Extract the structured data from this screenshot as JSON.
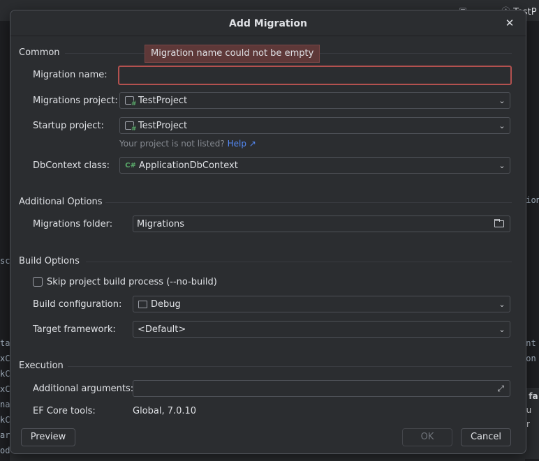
{
  "background": {
    "tab_label": "TestP",
    "left_fragments": [
      "sc",
      "ta",
      "xCo",
      "kCo",
      "xCo",
      "nar",
      "kCo",
      "art",
      "od"
    ],
    "right_fragments": [
      "tion",
      "int",
      "con"
    ],
    "popup_lines": [
      "nd fa",
      "e/su",
      "stPr"
    ]
  },
  "dialog": {
    "title": "Add Migration",
    "error_tooltip": "Migration name could not be empty",
    "sections": {
      "common": "Common",
      "additional": "Additional Options",
      "build": "Build Options",
      "execution": "Execution"
    },
    "fields": {
      "migration_name": {
        "label": "Migration name:",
        "value": ""
      },
      "migrations_project": {
        "label": "Migrations project:",
        "value": "TestProject",
        "icon": "csharp-project-icon"
      },
      "startup_project": {
        "label": "Startup project:",
        "value": "TestProject",
        "icon": "csharp-project-icon"
      },
      "project_hint": {
        "text": "Your project is not listed?",
        "link": "Help ↗"
      },
      "dbcontext_class": {
        "label": "DbContext class:",
        "value": "ApplicationDbContext",
        "icon": "C#"
      },
      "migrations_folder": {
        "label": "Migrations folder:",
        "value": "Migrations",
        "icon": "folder-icon"
      },
      "skip_build": {
        "label": "Skip project build process (--no-build)",
        "checked": false
      },
      "build_configuration": {
        "label": "Build configuration:",
        "value": "Debug",
        "icon": "configuration-icon"
      },
      "target_framework": {
        "label": "Target framework:",
        "value": "<Default>"
      },
      "additional_arguments": {
        "label": "Additional arguments:",
        "value": "",
        "icon": "expand-icon"
      },
      "ef_core_tools": {
        "label": "EF Core tools:",
        "value": "Global, 7.0.10"
      }
    },
    "buttons": {
      "preview": "Preview",
      "ok": "OK",
      "cancel": "Cancel"
    }
  }
}
